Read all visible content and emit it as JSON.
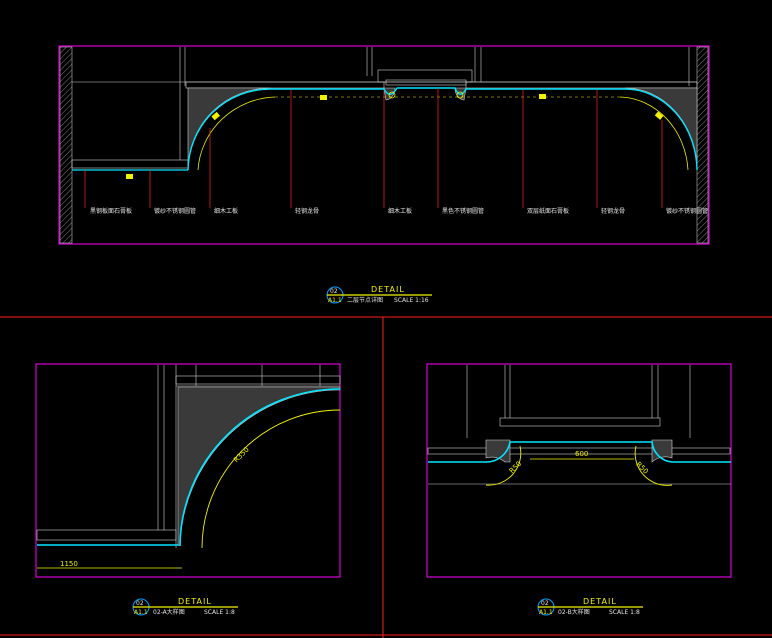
{
  "main": {
    "labels": [
      "黑钢板面石膏板",
      "镀纱不锈钢圆管",
      "细木工板",
      "轻钢龙骨",
      "细木工板",
      "黑色不锈钢圆管",
      "双层纸面石膏板",
      "轻钢龙骨",
      "镀纱不锈钢圆管"
    ],
    "title": "DETAIL",
    "badge_top": "02",
    "badge_bottom": "A1.1",
    "subtitle": "二层节点详图",
    "scale": "SCALE 1:16"
  },
  "detail_a": {
    "title": "DETAIL",
    "badge_top": "02",
    "badge_bottom": "A1.1",
    "subtitle": "02-A大样图",
    "scale": "SCALE 1:8",
    "dim_radius": "R350",
    "dim_width": "1150"
  },
  "detail_b": {
    "title": "DETAIL",
    "badge_top": "02",
    "badge_bottom": "A1.1",
    "subtitle": "02-B大样图",
    "scale": "SCALE 1:8",
    "dim_width": "600",
    "dim_r_left": "R50",
    "dim_r_right": "R50"
  },
  "colors": {
    "frame": "#ff00ff",
    "divider": "#ff2020",
    "cyan": "#00e5ff",
    "yellow": "#f2f200",
    "leader": "#ff2020",
    "fill": "#3a3a3a"
  }
}
